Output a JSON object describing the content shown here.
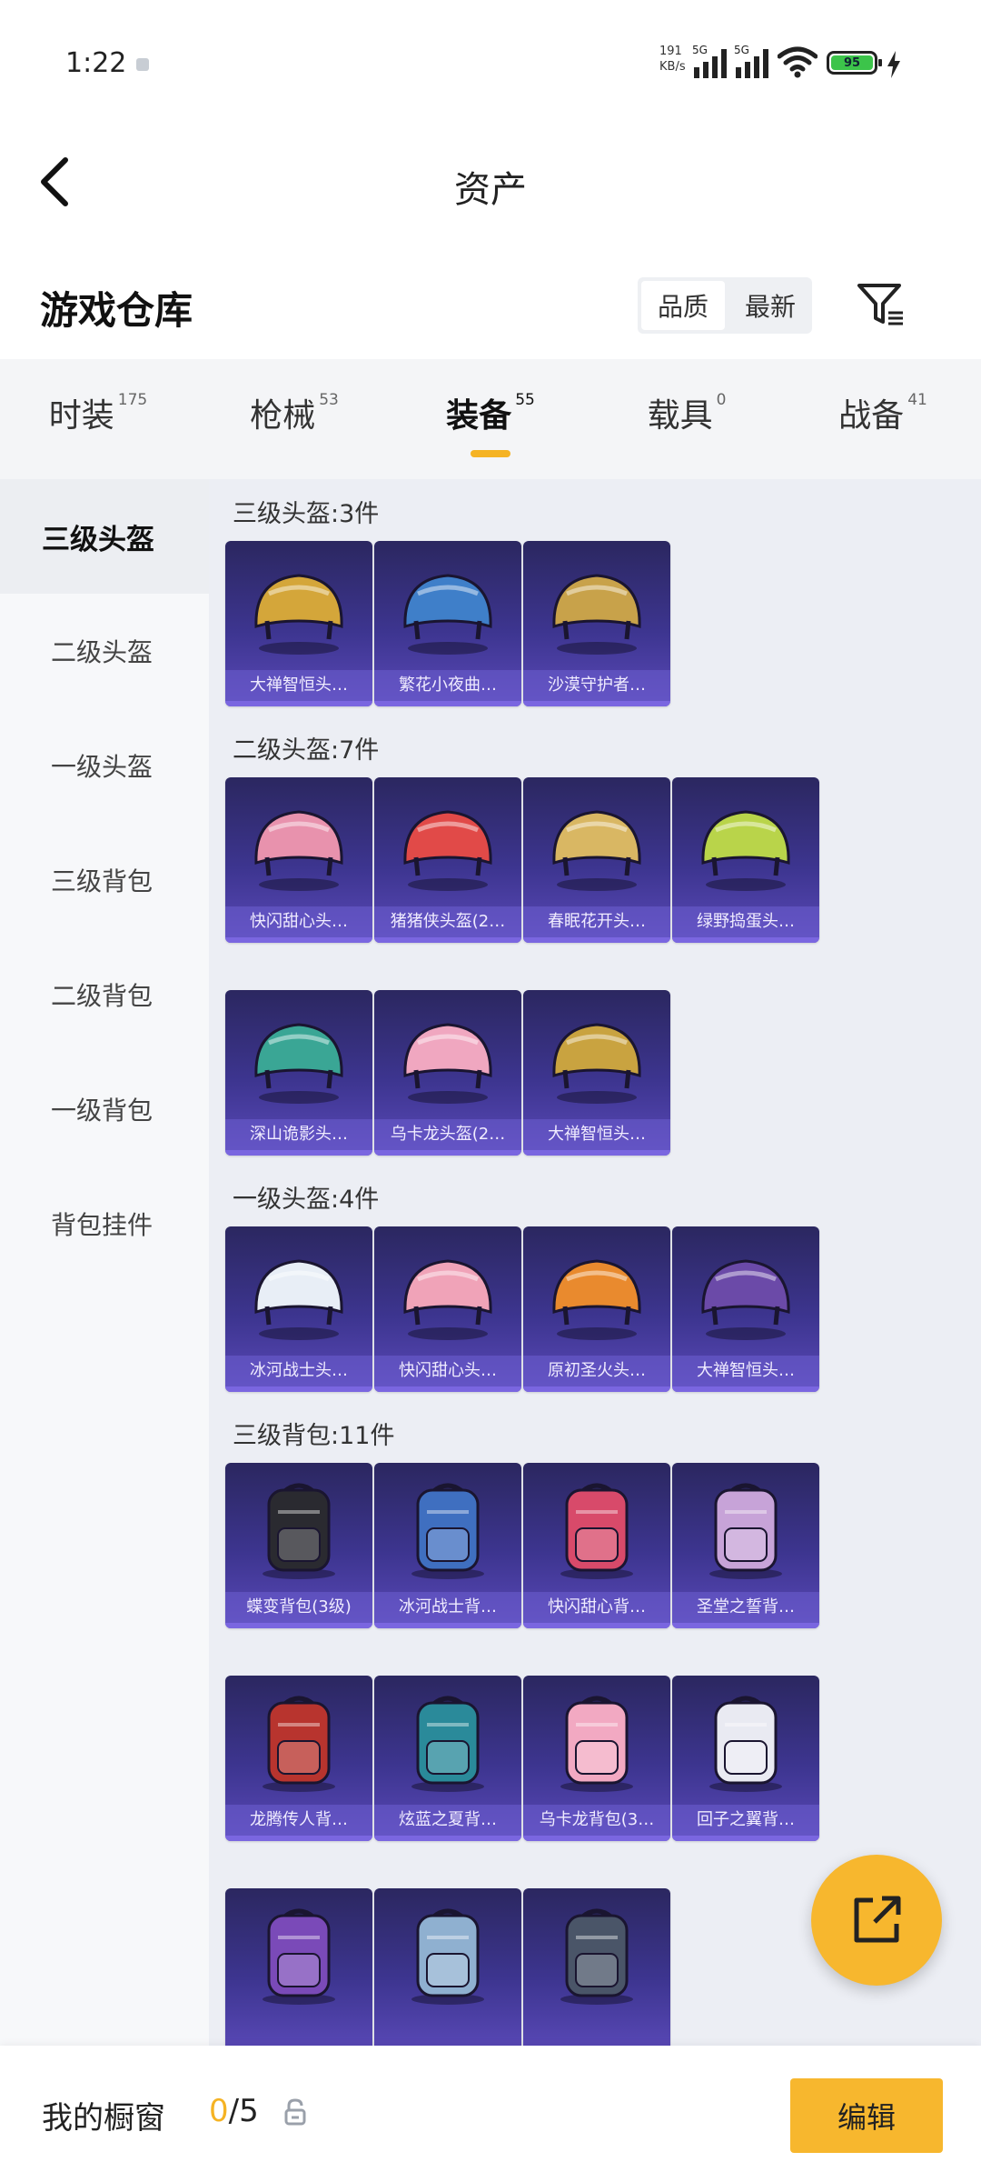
{
  "status_bar": {
    "time": "1:22",
    "net_speed_value": "191",
    "net_speed_unit": "KB/s",
    "network_tag_1": "5G",
    "network_tag_2": "5G",
    "battery": "95"
  },
  "header": {
    "title": "资产"
  },
  "warehouse": {
    "title": "游戏仓库",
    "sort_options": [
      "品质",
      "最新"
    ],
    "active_sort": 0
  },
  "tabs": [
    {
      "label": "时装",
      "count": "175"
    },
    {
      "label": "枪械",
      "count": "53"
    },
    {
      "label": "装备",
      "count": "55"
    },
    {
      "label": "载具",
      "count": "0"
    },
    {
      "label": "战备",
      "count": "41"
    }
  ],
  "active_tab": 2,
  "side_menu": [
    "三级头盔",
    "二级头盔",
    "一级头盔",
    "三级背包",
    "二级背包",
    "一级背包",
    "背包挂件"
  ],
  "active_side_item": 0,
  "sections": [
    {
      "label": "三级头盔:3件",
      "kind": "helmet",
      "items": [
        {
          "name": "大禅智恒头…",
          "color": "#d4a63a"
        },
        {
          "name": "繁花小夜曲…",
          "color": "#3f7fc9"
        },
        {
          "name": "沙漠守护者…",
          "color": "#c8a24a"
        }
      ]
    },
    {
      "label": "二级头盔:7件",
      "kind": "helmet",
      "items": [
        {
          "name": "快闪甜心头…",
          "color": "#e892ad"
        },
        {
          "name": "猪猪侠头盔(2…",
          "color": "#e14a48"
        },
        {
          "name": "春眠花开头…",
          "color": "#d9b763"
        },
        {
          "name": "绿野捣蛋头…",
          "color": "#b9d44a"
        },
        {
          "name": "深山诡影头…",
          "color": "#3aa695"
        },
        {
          "name": "乌卡龙头盔(2…",
          "color": "#f0a7c0"
        },
        {
          "name": "大禅智恒头…",
          "color": "#c9a340"
        }
      ]
    },
    {
      "label": "一级头盔:4件",
      "kind": "helmet",
      "items": [
        {
          "name": "冰河战士头…",
          "color": "#e8eef6"
        },
        {
          "name": "快闪甜心头…",
          "color": "#f0a3b8"
        },
        {
          "name": "原初圣火头…",
          "color": "#e98a2e"
        },
        {
          "name": "大禅智恒头…",
          "color": "#6b4aa8"
        }
      ]
    },
    {
      "label": "三级背包:11件",
      "kind": "backpack",
      "items": [
        {
          "name": "蝶变背包(3级)",
          "color": "#2a2a30"
        },
        {
          "name": "冰河战士背…",
          "color": "#3f6fc0"
        },
        {
          "name": "快闪甜心背…",
          "color": "#d84a6a"
        },
        {
          "name": "圣堂之誓背…",
          "color": "#c7a3d8"
        },
        {
          "name": "龙腾传人背…",
          "color": "#b8342e"
        },
        {
          "name": "炫蓝之夏背…",
          "color": "#2a8a9a"
        },
        {
          "name": "乌卡龙背包(3…",
          "color": "#f2a9c2"
        },
        {
          "name": "回子之翼背…",
          "color": "#e9eaf2"
        },
        {
          "name": "",
          "color": "#7a4ab8"
        },
        {
          "name": "",
          "color": "#8fb0d0"
        },
        {
          "name": "",
          "color": "#4a5568"
        }
      ]
    }
  ],
  "bottom_bar": {
    "showcase_label": "我的橱窗",
    "showcase_current": "0",
    "showcase_total": "/5",
    "edit_label": "编辑"
  },
  "accent_color": "#f7b72e"
}
